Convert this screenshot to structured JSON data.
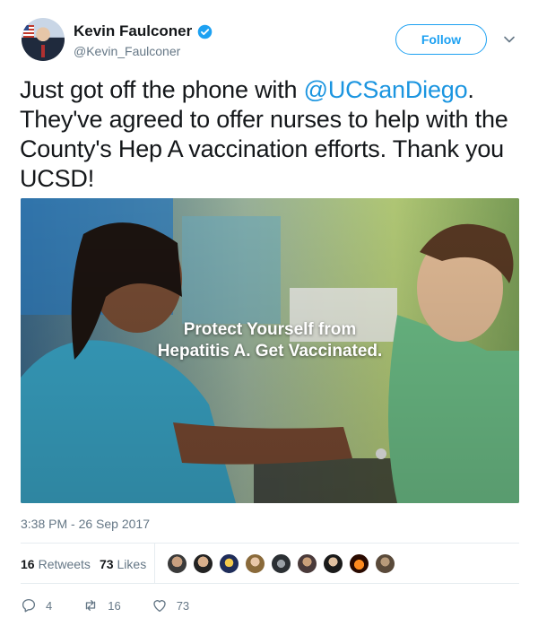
{
  "user": {
    "display_name": "Kevin Faulconer",
    "handle": "@Kevin_Faulconer",
    "verified": true
  },
  "follow_label": "Follow",
  "tweet": {
    "text_before": "Just got off the phone with ",
    "mention": "@UCSanDiego",
    "text_after": ". They've agreed to offer nurses to help with the County's Hep A vaccination efforts. Thank you UCSD!"
  },
  "media": {
    "overlay_line1": "Protect Yourself from",
    "overlay_line2": "Hepatitis A. Get Vaccinated."
  },
  "timestamp": "3:38 PM - 26 Sep 2017",
  "stats": {
    "retweets_count": "16",
    "retweets_label": "Retweets",
    "likes_count": "73",
    "likes_label": "Likes"
  },
  "actions": {
    "reply_count": "4",
    "retweet_count": "16",
    "like_count": "73"
  },
  "colors": {
    "accent": "#1da1f2",
    "mention": "#1b95e0",
    "muted": "#657786",
    "text": "#14171a"
  }
}
